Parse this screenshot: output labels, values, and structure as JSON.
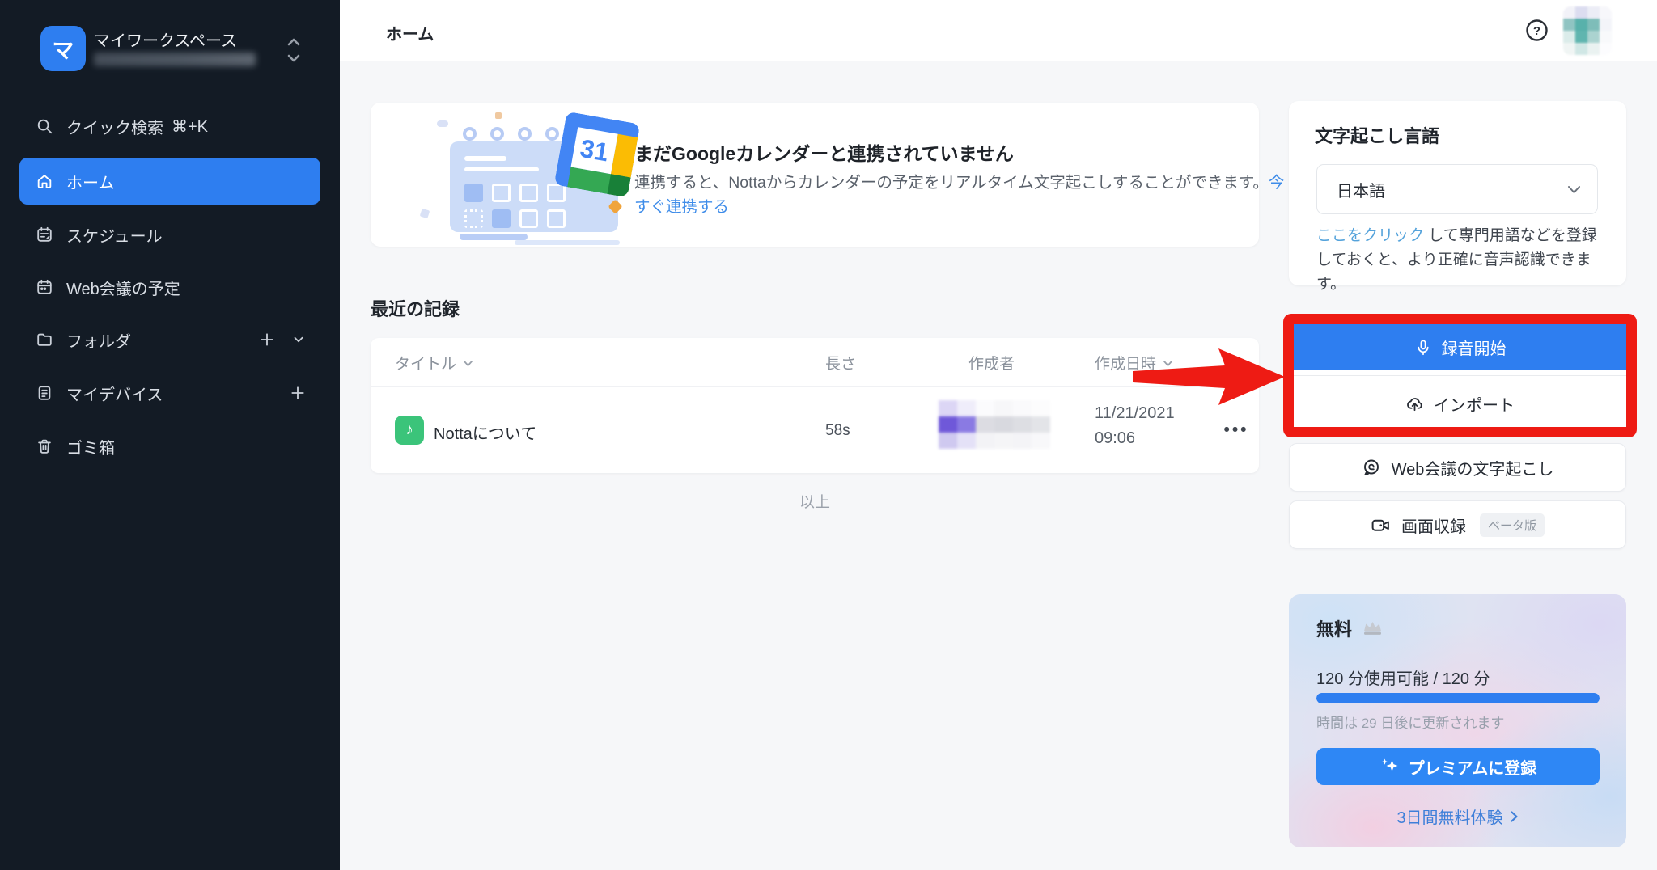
{
  "topbar": {
    "title": "ホーム"
  },
  "sidebar": {
    "workspace": {
      "initial": "マ",
      "name": "マイワークスペース"
    },
    "search": {
      "label": "クイック検索",
      "shortcut": "⌘+K"
    },
    "items": [
      {
        "label": "ホーム",
        "active": true
      },
      {
        "label": "スケジュール"
      },
      {
        "label": "Web会議の予定"
      },
      {
        "label": "フォルダ"
      },
      {
        "label": "マイデバイス"
      },
      {
        "label": "ゴミ箱"
      }
    ]
  },
  "banner": {
    "title": "まだGoogleカレンダーと連携されていません",
    "body": "連携すると、Nottaからカレンダーの予定をリアルタイム文字起こしすることができます。",
    "link": "今すぐ連携する",
    "calendar_day": "31"
  },
  "recent": {
    "heading": "最近の記録",
    "columns": {
      "title": "タイトル",
      "length": "長さ",
      "creator": "作成者",
      "created": "作成日時"
    },
    "row": {
      "title": "Nottaについて",
      "length": "58s",
      "created_date": "11/21/2021",
      "created_time": "09:06",
      "menu": "•••"
    },
    "end_label": "以上"
  },
  "right_panel": {
    "language": {
      "heading": "文字起こし言語",
      "selected": "日本語",
      "hint_link": "ここをクリック",
      "hint_rest": " して専門用語などを登録しておくと、より正確に音声認識できます。"
    },
    "record_label": "録音開始",
    "import_label": "インポート",
    "web_transcribe_label": "Web会議の文字起こし",
    "screen_record_label": "画面収録",
    "beta_badge": "ベータ版",
    "plan": {
      "name": "無料",
      "usage": "120 分使用可能 / 120 分",
      "progress_percent": 100,
      "renew_note": "時間は 29 日後に更新されます",
      "upgrade_label": "プレミアムに登録",
      "trial_link": "3日間無料体験"
    }
  },
  "colors": {
    "accent_blue": "#2E7EF0",
    "annotation_red": "#EE1B14",
    "link_blue": "#3E8CE9",
    "hint_link_blue": "#55A3DB",
    "record_green": "#3BC47A"
  }
}
